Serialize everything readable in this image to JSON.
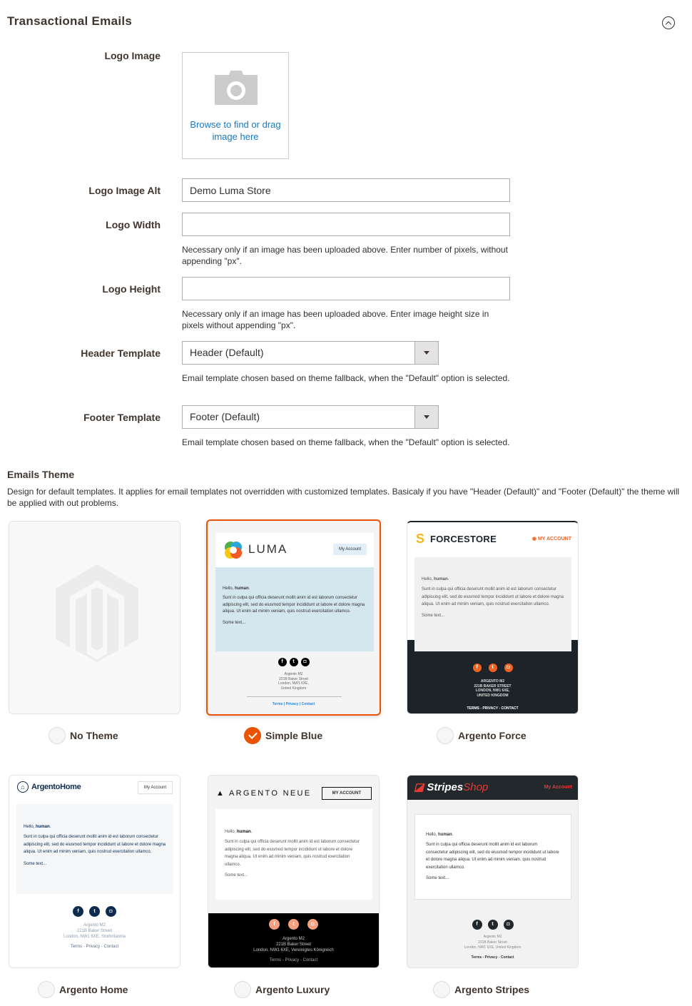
{
  "section": {
    "title": "Transactional Emails",
    "collapse_icon": "chevron-up-circle-icon"
  },
  "fields": {
    "logo_image": {
      "label": "Logo Image",
      "upload_text": "Browse to find or drag image here",
      "icon": "camera-icon"
    },
    "logo_alt": {
      "label": "Logo Image Alt",
      "value": "Demo Luma Store"
    },
    "logo_width": {
      "label": "Logo Width",
      "value": "",
      "note": "Necessary only if an image has been uploaded above. Enter number of pixels, without appending \"px\"."
    },
    "logo_height": {
      "label": "Logo Height",
      "value": "",
      "note": "Necessary only if an image has been uploaded above. Enter image height size in pixels without appending \"px\"."
    },
    "header_template": {
      "label": "Header Template",
      "value": "Header (Default)",
      "note": "Email template chosen based on theme fallback, when the \"Default\" option is selected."
    },
    "footer_template": {
      "label": "Footer Template",
      "value": "Footer (Default)",
      "note": "Email template chosen based on theme fallback, when the \"Default\" option is selected."
    }
  },
  "themes": {
    "title": "Emails Theme",
    "description": "Design for default templates. It applies for email templates not overridden with customized templates. Basicaly if you have \"Header (Default)\" and \"Footer (Default)\" the theme will be applied with out problems.",
    "selected": "Simple Blue",
    "preview": {
      "hello": "Hello,",
      "name": "human",
      "body": "Sunt in culpa qui officia deserunt mollit anim id est laborum consectetur adipiscing elit, sed do eiusmod tempor incididunt ut labore et dolore magna aliqua. Ut enim ad minim veniam, quis nostrud exercitation ullamco.",
      "some_text": "Some text...",
      "company": "Argento M2",
      "street": "221B Baker Street"
    },
    "items": [
      {
        "label": "No Theme",
        "selected": false
      },
      {
        "label": "Simple Blue",
        "selected": true,
        "brand": "LUMA",
        "account": "My Account",
        "city": "London, NW1 6XE,",
        "country": "United Kingdom",
        "links": "Terms | Privacy | Contact",
        "bg": "#d4e6ee"
      },
      {
        "label": "Argento Force",
        "selected": false,
        "brand": "FORCESTORE",
        "account": "MY ACCOUNT",
        "company": "ARGENTO M2",
        "street": "221B BAKER STREET",
        "city": "LONDON, NW1 6XE,",
        "country": "UNITED KINGDOM",
        "links": "TERMS - PRIVACY - CONTACT",
        "accent": "#f26322"
      },
      {
        "label": "Argento Home",
        "selected": false,
        "brand": "ArgentoHome",
        "account": "My Account",
        "city": "London, NW1 6XE, Storbritannia",
        "links": "Terms - Privacy - Contact",
        "accent": "#0d2b4e"
      },
      {
        "label": "Argento Luxury",
        "selected": false,
        "brand": "ARGENTO NEUE",
        "account": "MY ACCOUNT",
        "city": "London, NW1 6XE, Vereinigtes Königreich",
        "links": "Terms - Privacy - Contact",
        "accent": "#f4a081"
      },
      {
        "label": "Argento Stripes",
        "selected": false,
        "brand_a": "Stripes",
        "brand_b": "Shop",
        "account": "My Account",
        "city": "London, NW1 6XE, United Kingdom",
        "links": "Terms - Privacy - Contact",
        "accent": "#e53935"
      }
    ]
  }
}
